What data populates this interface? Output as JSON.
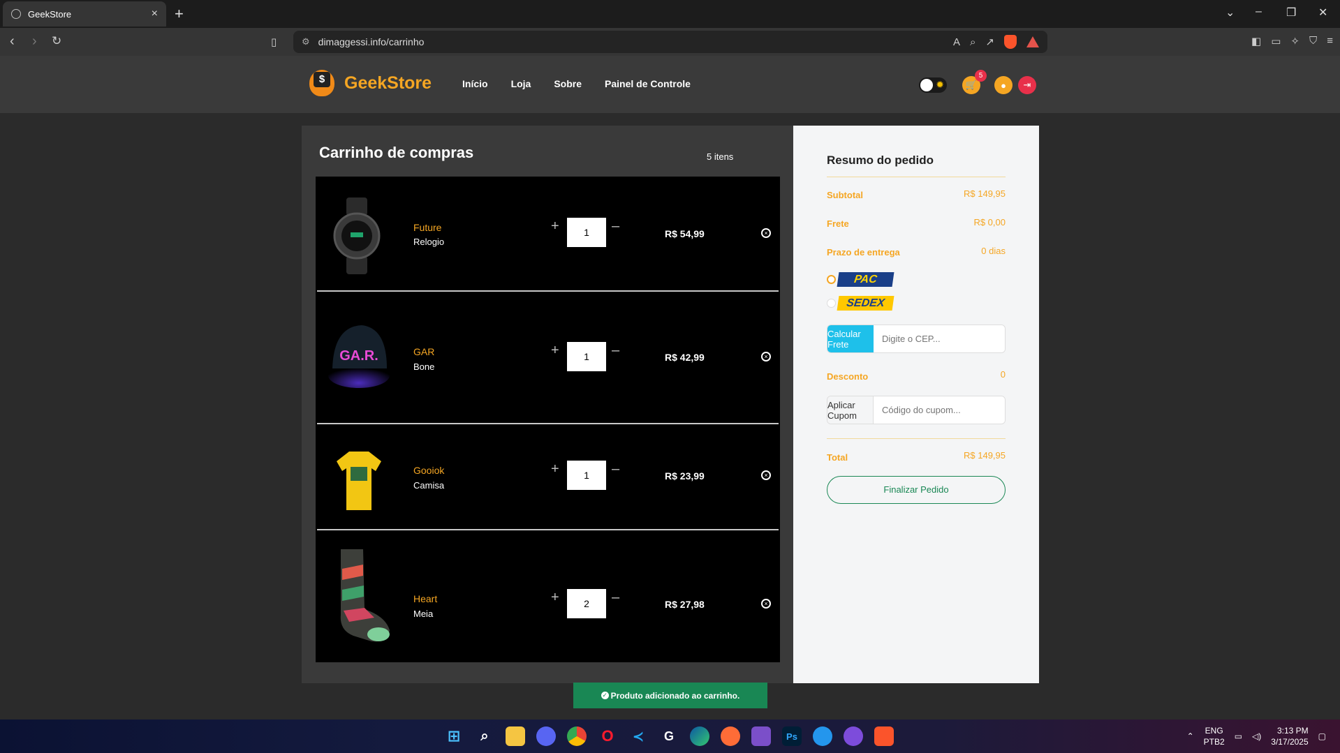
{
  "browser": {
    "tab_title": "GeekStore",
    "url": "dimaggessi.info/carrinho"
  },
  "site": {
    "logo_text": "GeekStore",
    "logo_mark": "$",
    "nav": [
      "Início",
      "Loja",
      "Sobre",
      "Painel de Controle"
    ],
    "cart_badge": "5"
  },
  "cart": {
    "title": "Carrinho de compras",
    "count_label": "5 itens",
    "items": [
      {
        "name": "Future",
        "category": "Relogio",
        "qty": "1",
        "price": "R$ 54,99",
        "icon": "watch-image"
      },
      {
        "name": "GAR",
        "category": "Bone",
        "qty": "1",
        "price": "R$ 42,99",
        "icon": "cap-image"
      },
      {
        "name": "Gooiok",
        "category": "Camisa",
        "qty": "1",
        "price": "R$ 23,99",
        "icon": "tshirt-image"
      },
      {
        "name": "Heart",
        "category": "Meia",
        "qty": "2",
        "price": "R$ 27,98",
        "icon": "sock-image"
      }
    ],
    "cap_text": "GA.R."
  },
  "summary": {
    "title": "Resumo do pedido",
    "subtotal_label": "Subtotal",
    "subtotal_value": "R$ 149,95",
    "shipping_label": "Frete",
    "shipping_value": "R$ 0,00",
    "delivery_label": "Prazo de entrega",
    "delivery_value": "0 dias",
    "carriers": [
      "PAC",
      "SEDEX"
    ],
    "calc_shipping_label": "Calcular Frete",
    "cep_placeholder": "Digite o CEP...",
    "discount_label": "Desconto",
    "discount_value": "0",
    "apply_coupon_label": "Aplicar Cupom",
    "coupon_placeholder": "Código do cupom...",
    "total_label": "Total",
    "total_value": "R$ 149,95",
    "finish_label": "Finalizar Pedido"
  },
  "toast": {
    "message": "Produto adicionado ao carrinho."
  },
  "taskbar": {
    "lang_top": "ENG",
    "lang_bottom": "PTB2",
    "time": "3:13 PM",
    "date": "3/17/2025"
  },
  "colors": {
    "accent": "#f5a623",
    "success": "#198754",
    "info": "#1ec0ea",
    "danger": "#e8304a"
  }
}
